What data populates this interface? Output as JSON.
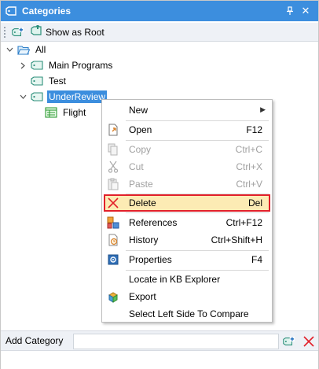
{
  "window": {
    "title": "Categories",
    "title_icon": "tag-icon",
    "pin_icon": "pin-icon",
    "close_icon": "close-icon",
    "accent_color": "#3c8ede"
  },
  "toolbar": {
    "new_category_icon": "new-tag-icon",
    "show_as_root_label": "Show as Root"
  },
  "tree": {
    "root": {
      "label": "All",
      "expanded": true
    },
    "children": [
      {
        "label": "Main Programs",
        "expandable": true
      },
      {
        "label": "Test",
        "expandable": false
      },
      {
        "label": "UnderReview",
        "expanded": true,
        "selected": true,
        "children": [
          {
            "label": "Flight",
            "icon": "transaction-icon"
          }
        ]
      }
    ]
  },
  "context_menu": {
    "items": [
      {
        "label": "New",
        "shortcut": "",
        "submenu": true,
        "enabled": true
      },
      {
        "label": "Open",
        "shortcut": "F12",
        "enabled": true
      },
      {
        "label": "Copy",
        "shortcut": "Ctrl+C",
        "enabled": false
      },
      {
        "label": "Cut",
        "shortcut": "Ctrl+X",
        "enabled": false
      },
      {
        "label": "Paste",
        "shortcut": "Ctrl+V",
        "enabled": false
      },
      {
        "label": "Delete",
        "shortcut": "Del",
        "enabled": true,
        "highlighted": true
      },
      {
        "label": "References",
        "shortcut": "Ctrl+F12",
        "enabled": true
      },
      {
        "label": "History",
        "shortcut": "Ctrl+Shift+H",
        "enabled": true
      },
      {
        "label": "Properties",
        "shortcut": "F4",
        "enabled": true
      },
      {
        "label": "Locate in KB Explorer",
        "shortcut": "",
        "enabled": true
      },
      {
        "label": "Export",
        "shortcut": "",
        "enabled": true
      },
      {
        "label": "Select Left Side To Compare",
        "shortcut": "",
        "enabled": true
      }
    ]
  },
  "bottom_bar": {
    "add_category_label": "Add Category",
    "input_value": "",
    "delete_color": "#e2202a"
  }
}
